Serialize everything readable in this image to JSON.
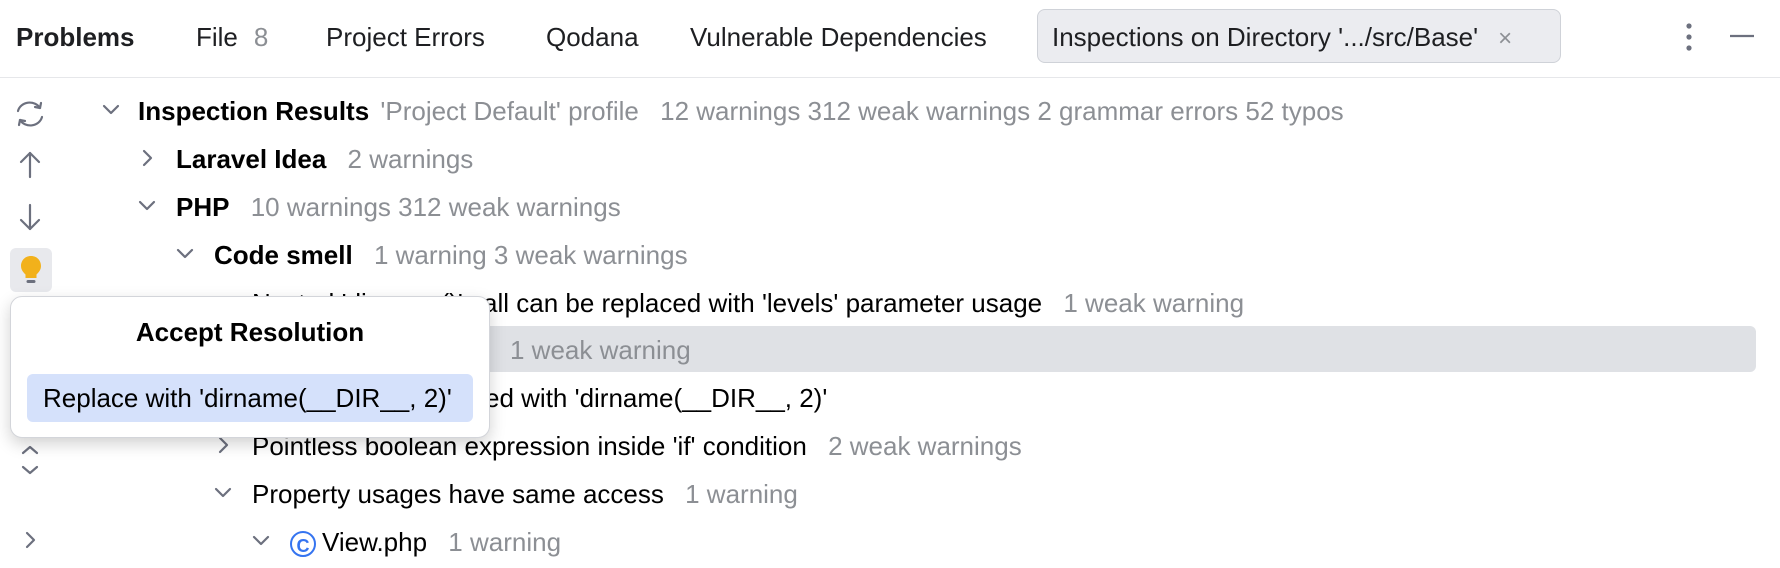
{
  "tabs": {
    "title": "Problems",
    "file_label": "File",
    "file_count": "8",
    "project_errors": "Project Errors",
    "qodana": "Qodana",
    "vulnerable": "Vulnerable Dependencies",
    "inspections": "Inspections on Directory '.../src/Base'",
    "close_glyph": "×"
  },
  "tree": {
    "root_label": "Inspection Results",
    "root_profile": "'Project Default' profile",
    "root_stats": "12 warnings 312 weak warnings 2 grammar errors 52 typos",
    "laravel_label": "Laravel Idea",
    "laravel_stats": "2 warnings",
    "php_label": "PHP",
    "php_stats": "10 warnings 312 weak warnings",
    "codesmell_label": "Code smell",
    "codesmell_stats": "1 warning 3 weak warnings",
    "nested_label": "Nested 'dirname()' call can be replaced with 'levels' parameter usage",
    "nested_stats": "1 weak warning",
    "sel_stats": "1 weak warning",
    "replace_suffix": "ced with 'dirname(__DIR__, 2)'",
    "pointless_label": "Pointless boolean expression inside 'if' condition",
    "pointless_stats": "2 weak warnings",
    "property_label": "Property usages have same access",
    "property_stats": "1 warning",
    "view_label": "View.php",
    "view_stats": "1 warning",
    "class_icon_letter": "C"
  },
  "popup": {
    "title": "Accept Resolution",
    "item": "Replace with 'dirname(__DIR__, 2)'"
  },
  "colors": {
    "accent": "#3574f0",
    "bulb": "#f2b11b",
    "muted": "#8c8f94",
    "selection": "#dfe1e5",
    "popup_item": "#d5e1fb"
  }
}
